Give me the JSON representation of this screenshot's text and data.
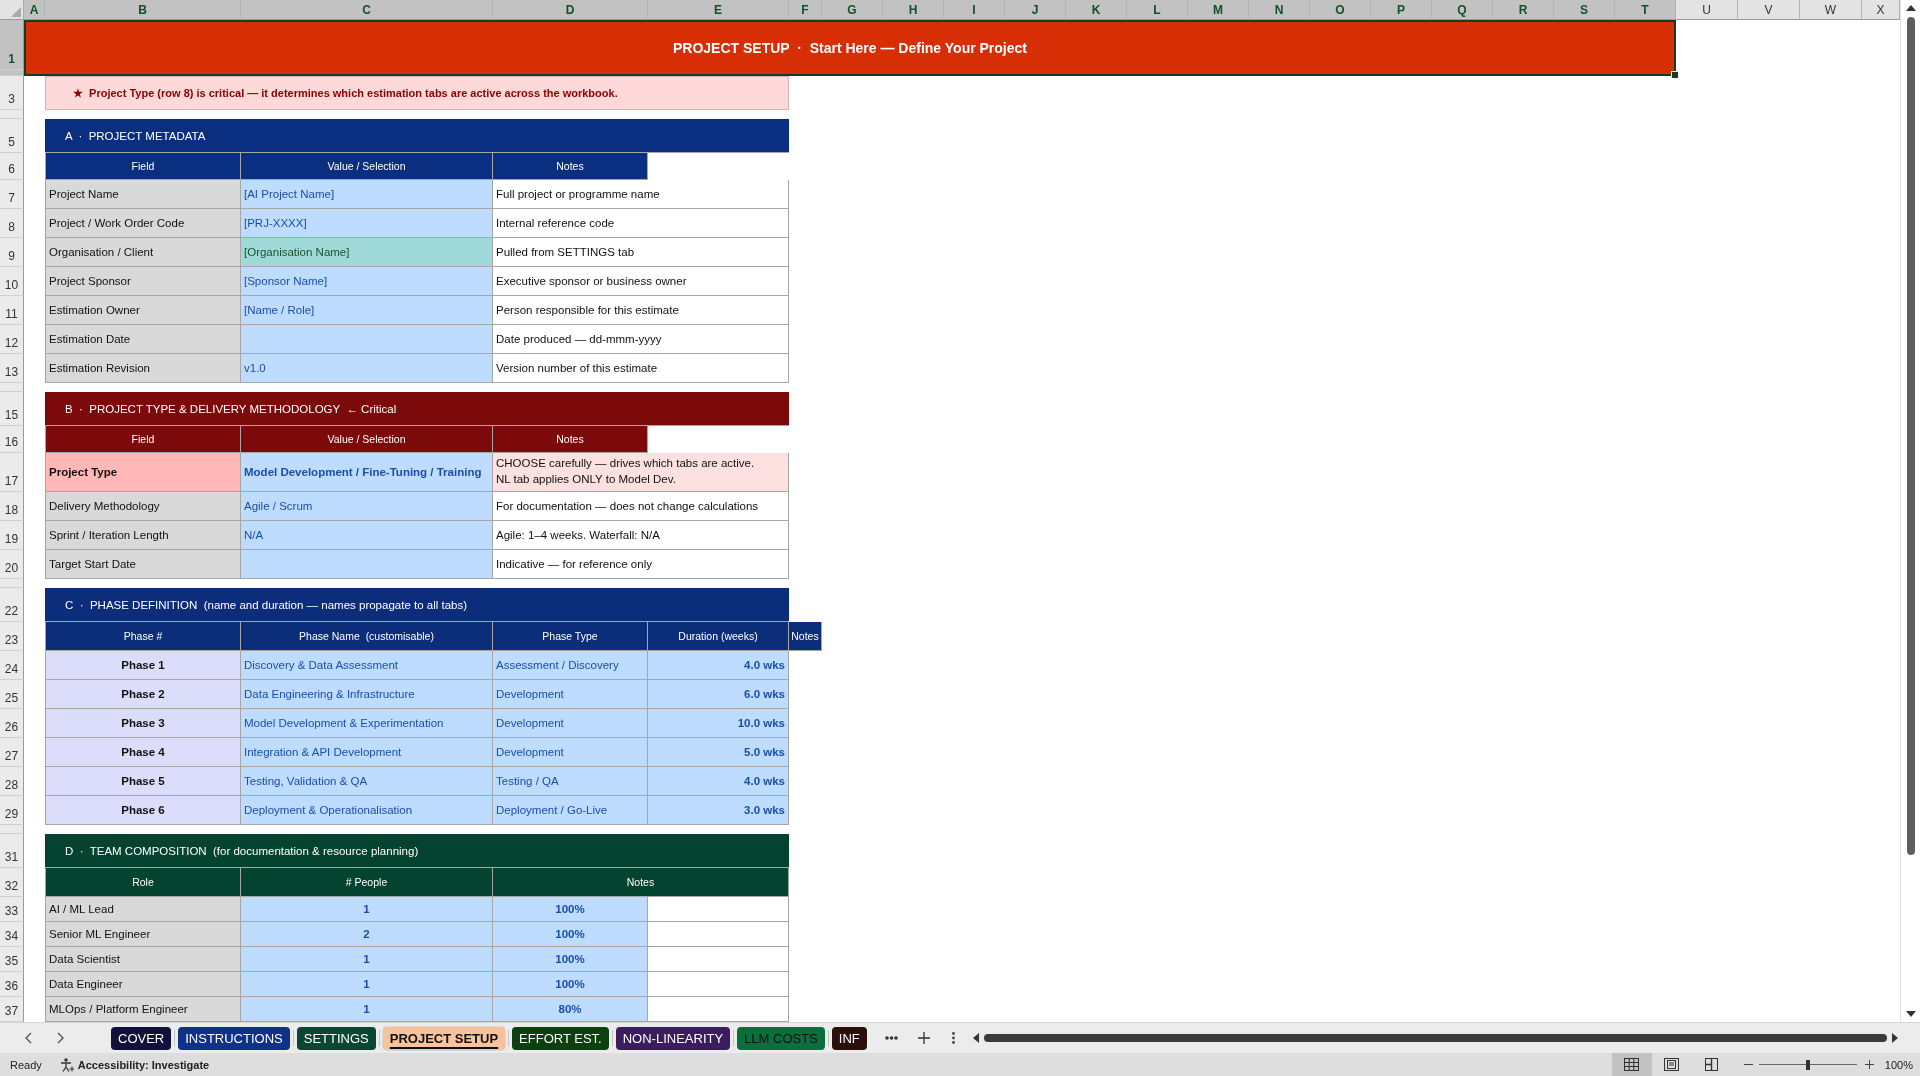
{
  "column_headers": [
    {
      "label": "A",
      "selected": true
    },
    {
      "label": "B",
      "selected": true
    },
    {
      "label": "C",
      "selected": true
    },
    {
      "label": "D",
      "selected": true
    },
    {
      "label": "E",
      "selected": true
    },
    {
      "label": "F",
      "selected": true
    },
    {
      "label": "G",
      "selected": true
    },
    {
      "label": "H",
      "selected": true
    },
    {
      "label": "I",
      "selected": true
    },
    {
      "label": "J",
      "selected": true
    },
    {
      "label": "K",
      "selected": true
    },
    {
      "label": "L",
      "selected": true
    },
    {
      "label": "M",
      "selected": true
    },
    {
      "label": "N",
      "selected": true
    },
    {
      "label": "O",
      "selected": true
    },
    {
      "label": "P",
      "selected": true
    },
    {
      "label": "Q",
      "selected": true
    },
    {
      "label": "R",
      "selected": true
    },
    {
      "label": "S",
      "selected": true
    },
    {
      "label": "T",
      "selected": true
    },
    {
      "label": "U",
      "selected": false
    },
    {
      "label": "V",
      "selected": false
    },
    {
      "label": "W",
      "selected": false
    },
    {
      "label": "X",
      "selected": false
    }
  ],
  "row_headers": [
    {
      "label": "1",
      "selected": true
    },
    {
      "selected": true
    },
    {
      "label": "3",
      "selected": false
    },
    {
      "selected": false
    },
    {
      "label": "5",
      "selected": false
    },
    {
      "label": "6",
      "selected": false
    },
    {
      "label": "7",
      "selected": false
    },
    {
      "label": "8",
      "selected": false
    },
    {
      "label": "9",
      "selected": false
    },
    {
      "label": "10",
      "selected": false
    },
    {
      "label": "11",
      "selected": false
    },
    {
      "label": "12",
      "selected": false
    },
    {
      "label": "13",
      "selected": false
    },
    {
      "selected": false
    },
    {
      "label": "15",
      "selected": false
    },
    {
      "label": "16",
      "selected": false
    },
    {
      "label": "17",
      "selected": false
    },
    {
      "label": "18",
      "selected": false
    },
    {
      "label": "19",
      "selected": false
    },
    {
      "label": "20",
      "selected": false
    },
    {
      "selected": false
    },
    {
      "label": "22",
      "selected": false
    },
    {
      "label": "23",
      "selected": false
    },
    {
      "label": "24",
      "selected": false
    },
    {
      "label": "25",
      "selected": false
    },
    {
      "label": "26",
      "selected": false
    },
    {
      "label": "27",
      "selected": false
    },
    {
      "label": "28",
      "selected": false
    },
    {
      "label": "29",
      "selected": false
    },
    {
      "selected": false
    },
    {
      "label": "31",
      "selected": false
    },
    {
      "label": "32",
      "selected": false
    },
    {
      "label": "33",
      "selected": false
    },
    {
      "label": "34",
      "selected": false
    },
    {
      "label": "35",
      "selected": false
    },
    {
      "label": "36",
      "selected": false
    },
    {
      "label": "37",
      "selected": false
    }
  ],
  "banner": {
    "text": "PROJECT SETUP  ·  Start Here — Define Your Project",
    "selected": true
  },
  "note": "★  Project Type (row 8) is critical — it determines which estimation tabs are active across the workbook.",
  "sections": [
    {
      "kind": "fields",
      "title": "A  ·  PROJECT METADATA",
      "color": "#0b2f80",
      "columns": [
        "Field",
        "Value / Selection",
        "Notes"
      ],
      "rows": [
        {
          "kind": "input",
          "field": "Project Name",
          "value": "[AI Project Name]",
          "note": "Full project or programme name"
        },
        {
          "kind": "input",
          "field": "Project / Work Order Code",
          "value": "[PRJ-XXXX]",
          "note": "Internal reference code"
        },
        {
          "kind": "linked",
          "field": "Organisation / Client",
          "value": "[Organisation Name]",
          "note": "Pulled from SETTINGS tab"
        },
        {
          "kind": "input",
          "field": "Project Sponsor",
          "value": "[Sponsor Name]",
          "note": "Executive sponsor or business owner"
        },
        {
          "kind": "input",
          "field": "Estimation Owner",
          "value": "[Name / Role]",
          "note": "Person responsible for this estimate"
        },
        {
          "kind": "input",
          "field": "Estimation Date",
          "note": "Date produced — dd-mmm-yyyy"
        },
        {
          "kind": "input",
          "field": "Estimation Revision",
          "value": "v1.0",
          "note": "Version number of this estimate"
        }
      ]
    },
    {
      "kind": "fields",
      "title": "B  ·  PROJECT TYPE & DELIVERY METHODOLOGY  ← Critical",
      "color": "#7d0a0a",
      "columns": [
        "Field",
        "Value / Selection",
        "Notes"
      ],
      "rows": [
        {
          "kind": "critical",
          "field": "Project Type",
          "value": "Model Development / Fine-Tuning / Training",
          "note": "CHOOSE carefully — drives which tabs are active. NL tab applies ONLY to Model Dev."
        },
        {
          "kind": "input",
          "field": "Delivery Methodology",
          "value": "Agile / Scrum",
          "note": "For documentation — does not change calculations"
        },
        {
          "kind": "input",
          "field": "Sprint / Iteration Length",
          "value": "N/A",
          "note": "Agile: 1–4 weeks. Waterfall: N/A"
        },
        {
          "kind": "input",
          "field": "Target Start Date",
          "note": "Indicative — for reference only"
        }
      ]
    },
    {
      "kind": "phases",
      "title": "C  ·  PHASE DEFINITION  (name and duration — names propagate to all tabs)",
      "color": "#0c2d7a",
      "columns": [
        "Phase #",
        "Phase Name  (customisable)",
        "Phase Type",
        "Duration (weeks)",
        "Notes"
      ],
      "rows": [
        {
          "phase": "Phase 1",
          "name": "Discovery & Data Assessment",
          "type": "Assessment / Discovery",
          "duration": "4.0 wks"
        },
        {
          "phase": "Phase 2",
          "name": "Data Engineering & Infrastructure",
          "type": "Development",
          "duration": "6.0 wks"
        },
        {
          "phase": "Phase 3",
          "name": "Model Development & Experimentation",
          "type": "Development",
          "duration": "10.0 wks"
        },
        {
          "phase": "Phase 4",
          "name": "Integration & API Development",
          "type": "Development",
          "duration": "5.0 wks"
        },
        {
          "phase": "Phase 5",
          "name": "Testing, Validation & QA",
          "type": "Testing / QA",
          "duration": "4.0 wks"
        },
        {
          "phase": "Phase 6",
          "name": "Deployment & Operationalisation",
          "type": "Deployment / Go-Live",
          "duration": "3.0 wks"
        }
      ]
    },
    {
      "kind": "team",
      "title": "D  ·  TEAM COMPOSITION  (for documentation & resource planning)",
      "color": "#04432f",
      "columns": [
        "Role",
        "# People",
        "Notes"
      ],
      "rows": [
        {
          "role": "AI / ML Lead",
          "people": "1",
          "notes": "100%"
        },
        {
          "role": "Senior ML Engineer",
          "people": "2",
          "notes": "100%"
        },
        {
          "role": "Data Scientist",
          "people": "1",
          "notes": "100%"
        },
        {
          "role": "Data Engineer",
          "people": "1",
          "notes": "100%"
        },
        {
          "role": "MLOps / Platform Engineer",
          "people": "1",
          "notes": "80%"
        }
      ]
    }
  ],
  "sheet_tabs": [
    {
      "label": "COVER",
      "color": "#10103a",
      "selected": false
    },
    {
      "label": "INSTRUCTIONS",
      "color": "#0e3189",
      "selected": false
    },
    {
      "label": "SETTINGS",
      "color": "#0a4632",
      "selected": false
    },
    {
      "label": "PROJECT SETUP",
      "color": "#f6c39c",
      "selected": true
    },
    {
      "label": "EFFORT EST.",
      "color": "#0d3f10",
      "selected": false
    },
    {
      "label": "NON-LINEARITY",
      "color": "#3b1d5e",
      "selected": false
    },
    {
      "label": "LLM COSTS",
      "color": "#0b6e3d",
      "selected": false
    },
    {
      "label": "INF",
      "color": "#2c0f0b",
      "selected": false
    }
  ],
  "status_bar": {
    "status": "Ready",
    "accessibility": "Accessibility: Investigate",
    "views": [
      {
        "kind": "normal",
        "selected": true
      },
      {
        "kind": "page_layout",
        "selected": false
      },
      {
        "kind": "page_break",
        "selected": false
      }
    ],
    "zoom": {
      "level": 0.5,
      "reading": "100%"
    }
  }
}
